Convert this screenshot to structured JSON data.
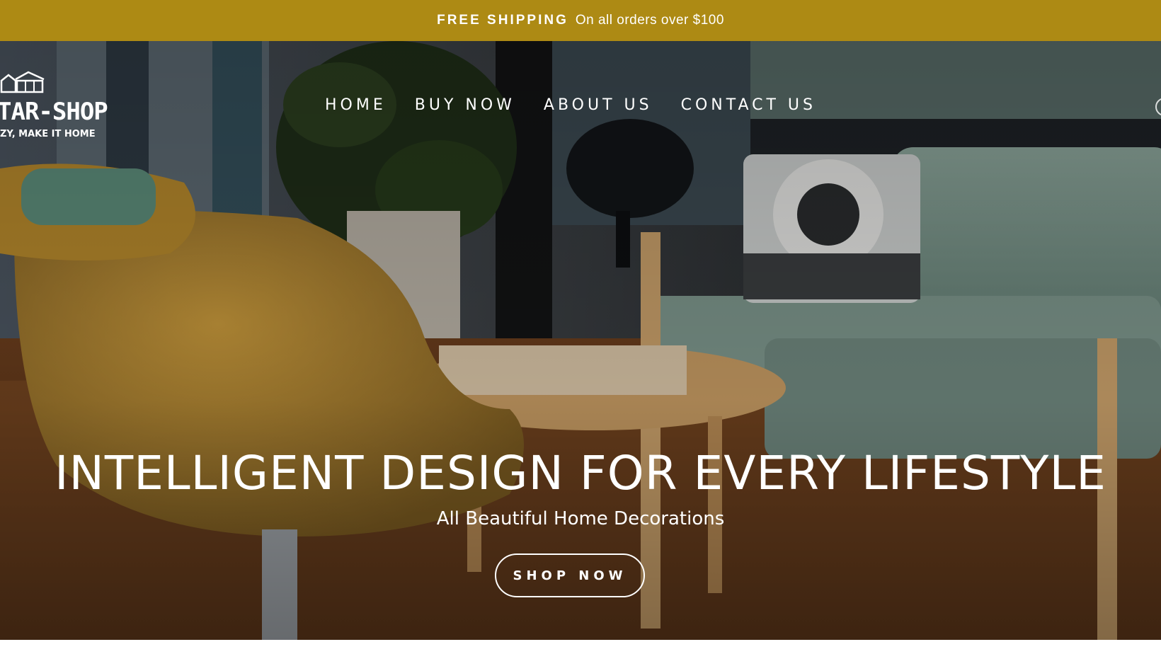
{
  "announcement": {
    "strong": "FREE SHIPPING",
    "text": "On all orders over $100"
  },
  "logo": {
    "brand": "TAR-SHOP",
    "tagline": "ZY, MAKE IT HOME"
  },
  "nav": {
    "items": [
      "HOME",
      "BUY NOW",
      "ABOUT US",
      "CONTACT US"
    ]
  },
  "hero": {
    "headline": "INTELLIGENT DESIGN FOR EVERY LIFESTYLE",
    "subheadline": "All Beautiful Home Decorations",
    "cta": "SHOP NOW"
  },
  "colors": {
    "announcement_bg": "#ad8a14",
    "text": "#ffffff"
  }
}
